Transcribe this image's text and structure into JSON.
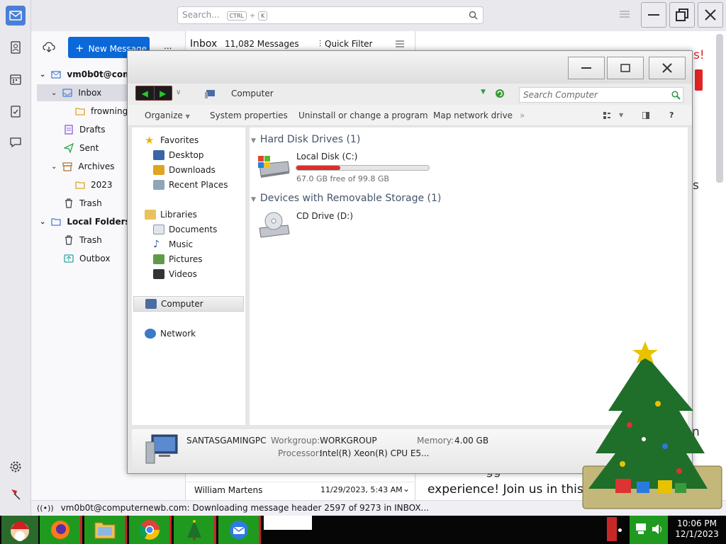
{
  "thunderbird": {
    "search_placeholder": "Search...",
    "search_shortcut_ctrl": "CTRL",
    "search_shortcut_plus": "+",
    "search_shortcut_k": "K",
    "new_message": "New Message",
    "more": "...",
    "account": "vm0b0t@compu",
    "folders": [
      {
        "label": "Inbox"
      },
      {
        "label": "frowning"
      },
      {
        "label": "Drafts"
      },
      {
        "label": "Sent"
      },
      {
        "label": "Archives"
      },
      {
        "label": "2023"
      },
      {
        "label": "Trash"
      },
      {
        "label": "Local Folders"
      },
      {
        "label": "Trash"
      },
      {
        "label": "Outbox"
      }
    ],
    "folder_title": "Inbox",
    "message_count": "11,082 Messages",
    "quick_filter": "Quick Filter",
    "message_row": {
      "sender": "William Martens",
      "date": "11/29/2023, 5:43 AM"
    },
    "reader_snippet_1": "s!",
    "reader_snippet_2": "s",
    "reader_snippet_3": "n",
    "reader_text": "experience! Join us in this",
    "reader_text_cut": "gg",
    "status_message": "vm0b0t@computernewb.com: Downloading message header 2597 of 9273 in INBOX..."
  },
  "explorer": {
    "breadcrumb": "Computer",
    "search_placeholder": "Search Computer",
    "toolbar": {
      "organize": "Organize",
      "system_properties": "System properties",
      "uninstall": "Uninstall or change a program",
      "map_drive": "Map network drive",
      "more": "»",
      "help": "?"
    },
    "nav": {
      "favorites": "Favorites",
      "desktop": "Desktop",
      "downloads": "Downloads",
      "recent": "Recent Places",
      "libraries": "Libraries",
      "documents": "Documents",
      "music": "Music",
      "pictures": "Pictures",
      "videos": "Videos",
      "computer": "Computer",
      "network": "Network"
    },
    "groups": {
      "hdd": "Hard Disk Drives (1)",
      "removable": "Devices with Removable Storage (1)"
    },
    "drives": {
      "c_name": "Local Disk (C:)",
      "c_free": "67.0 GB free of 99.8 GB",
      "c_used_fraction": 0.33,
      "d_name": "CD Drive (D:)"
    },
    "details": {
      "pc_name": "SANTASGAMINGPC",
      "workgroup_label": "Workgroup:",
      "workgroup": "WORKGROUP",
      "memory_label": "Memory:",
      "memory": "4.00 GB",
      "processor_label": "Processor:",
      "processor": "Intel(R) Xeon(R) CPU E5..."
    }
  },
  "taskbar": {
    "time": "10:06 PM",
    "date": "12/1/2023"
  },
  "colors": {
    "accent": "#0a68d8",
    "taskbar_green": "#1f9a1f",
    "taskbar_red": "#c62828",
    "drive_bar": "#d9302c"
  }
}
